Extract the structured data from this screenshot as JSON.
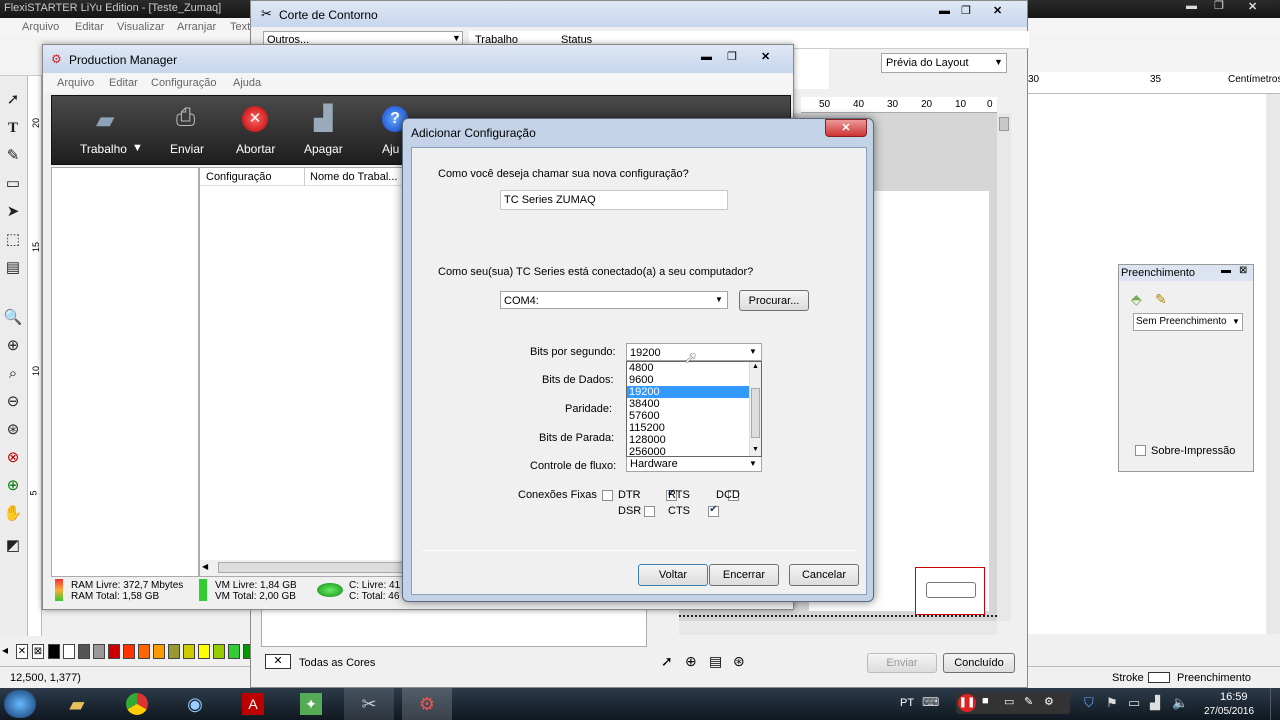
{
  "main_window": {
    "title": "FlexiSTARTER LiYu Edition - [Teste_Zumaq]",
    "menu": [
      "Arquivo",
      "Editar",
      "Visualizar",
      "Arranjar",
      "Text"
    ]
  },
  "corte": {
    "title": "Corte de Contorno",
    "dropdown": "Outros...",
    "col_trabalho": "Trabalho",
    "col_status": "Status",
    "all_colors": "Todas as Cores",
    "send_label": "Enviar",
    "done_label": "Concluído"
  },
  "layout_preview": {
    "label": "Prévia do Layout"
  },
  "ruler": {
    "labels": [
      "50",
      "40",
      "30",
      "20",
      "10",
      "0"
    ],
    "right_labels": [
      "30",
      "35",
      "Centímetros"
    ],
    "left_labels": [
      "20",
      "15",
      "10",
      "5"
    ]
  },
  "production_manager": {
    "title": "Production Manager",
    "menu": [
      "Arquivo",
      "Editar",
      "Configuração",
      "Ajuda"
    ],
    "toolbar": {
      "trabalho": "Trabalho",
      "enviar": "Enviar",
      "abortar": "Abortar",
      "apagar": "Apagar",
      "ajuda": "Aju"
    },
    "columns": [
      "Configuração",
      "Nome do Trabal..."
    ],
    "status": {
      "ram_free": "RAM Livre: 372,7 Mbytes",
      "ram_total": "RAM Total: 1,58 GB",
      "vm_free": "VM Livre: 1,84 GB",
      "vm_total": "VM Total: 2,00 GB",
      "c_free": "C: Livre: 41",
      "c_total": "C: Total: 46"
    }
  },
  "dialog": {
    "title": "Adicionar Configuração",
    "q_name": "Como você deseja chamar sua nova configuração?",
    "name_value": "TC Series ZUMAQ",
    "q_port": "Como seu(sua) TC Series está conectado(a) a seu computador?",
    "port_value": "COM4:",
    "browse": "Procurar...",
    "bits_label": "Bits por segundo:",
    "bits_value": "19200",
    "bits_options": [
      "4800",
      "9600",
      "19200",
      "38400",
      "57600",
      "115200",
      "128000",
      "256000"
    ],
    "bits_selected": "19200",
    "data_bits_label": "Bits de Dados:",
    "parity_label": "Paridade:",
    "stop_bits_label": "Bits de Parada:",
    "flow_label": "Controle de fluxo:",
    "flow_value": "Hardware",
    "fixed_label": "Conexões Fixas",
    "dtr": "DTR",
    "rts": "RTS",
    "dcd": "DCD",
    "dsr": "DSR",
    "cts": "CTS",
    "dtr_checked": false,
    "rts_checked": true,
    "dcd_checked": false,
    "dsr_checked": false,
    "cts_checked": true,
    "back": "Voltar",
    "close": "Encerrar",
    "cancel": "Cancelar"
  },
  "fill_panel": {
    "title": "Preenchimento",
    "dropdown": "Sem Preenchimento",
    "overprint": "Sobre-Impressão"
  },
  "statusbar": {
    "coords": "12,500,   1,377)",
    "stroke": "Stroke",
    "fill": "Preenchimento"
  },
  "palette": [
    "#000000",
    "#ffffff",
    "#555555",
    "#999999",
    "#cc0000",
    "#ff3300",
    "#ff6600",
    "#ff9900",
    "#999933",
    "#cccc00",
    "#ffff00",
    "#99cc00",
    "#33cc33",
    "#009900"
  ],
  "taskbar": {
    "lang": "PT",
    "time": "16:59",
    "date": "27/05/2016"
  }
}
